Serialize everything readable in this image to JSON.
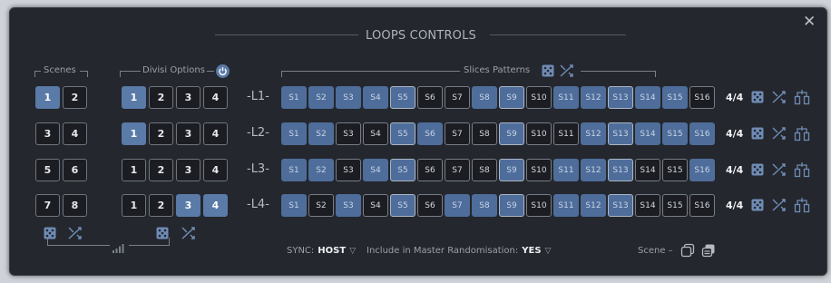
{
  "window": {
    "title": "LOOPS CONTROLS",
    "close_glyph": "✕"
  },
  "scenes": {
    "label": "Scenes",
    "buttons": [
      "1",
      "2",
      "3",
      "4",
      "5",
      "6",
      "7",
      "8"
    ],
    "selected": "1"
  },
  "divisi": {
    "label": "Divisi Options",
    "power_icon": "power-icon",
    "rows": [
      {
        "buttons": [
          "1",
          "2",
          "3",
          "4"
        ],
        "selected": [
          "1"
        ]
      },
      {
        "buttons": [
          "1",
          "2",
          "3",
          "4"
        ],
        "selected": [
          "1"
        ]
      },
      {
        "buttons": [
          "1",
          "2",
          "3",
          "4"
        ],
        "selected": []
      },
      {
        "buttons": [
          "1",
          "2",
          "3",
          "4"
        ],
        "selected": [
          "3",
          "4"
        ]
      }
    ]
  },
  "slices": {
    "label": "Slices Patterns",
    "names": [
      "S1",
      "S2",
      "S3",
      "S4",
      "S5",
      "S6",
      "S7",
      "S8",
      "S9",
      "S10",
      "S11",
      "S12",
      "S13",
      "S14",
      "S15",
      "S16"
    ],
    "loops": [
      {
        "label": "-L1-",
        "on": [
          1,
          1,
          1,
          1,
          1,
          0,
          0,
          1,
          1,
          0,
          1,
          1,
          1,
          1,
          1,
          0
        ],
        "ratio": "4/4"
      },
      {
        "label": "-L2-",
        "on": [
          1,
          1,
          0,
          0,
          1,
          1,
          0,
          0,
          1,
          0,
          0,
          1,
          1,
          1,
          1,
          1
        ],
        "ratio": "4/4"
      },
      {
        "label": "-L3-",
        "on": [
          1,
          1,
          0,
          1,
          1,
          0,
          0,
          0,
          1,
          0,
          1,
          1,
          1,
          0,
          0,
          1
        ],
        "ratio": "4/4"
      },
      {
        "label": "-L4-",
        "on": [
          1,
          0,
          1,
          0,
          1,
          0,
          1,
          1,
          1,
          0,
          1,
          1,
          1,
          0,
          0,
          0
        ],
        "ratio": "4/4"
      }
    ],
    "highlight_positions": [
      5,
      9,
      13
    ]
  },
  "footer": {
    "sync_label": "SYNC:",
    "sync_value": "HOST",
    "master_label": "Include in Master Randomisation:",
    "master_value": "YES",
    "scene_label": "Scene –"
  },
  "colors": {
    "accent": "#5a7aa8",
    "slice_on": "#4f6d9a",
    "panel": "#24272d"
  }
}
